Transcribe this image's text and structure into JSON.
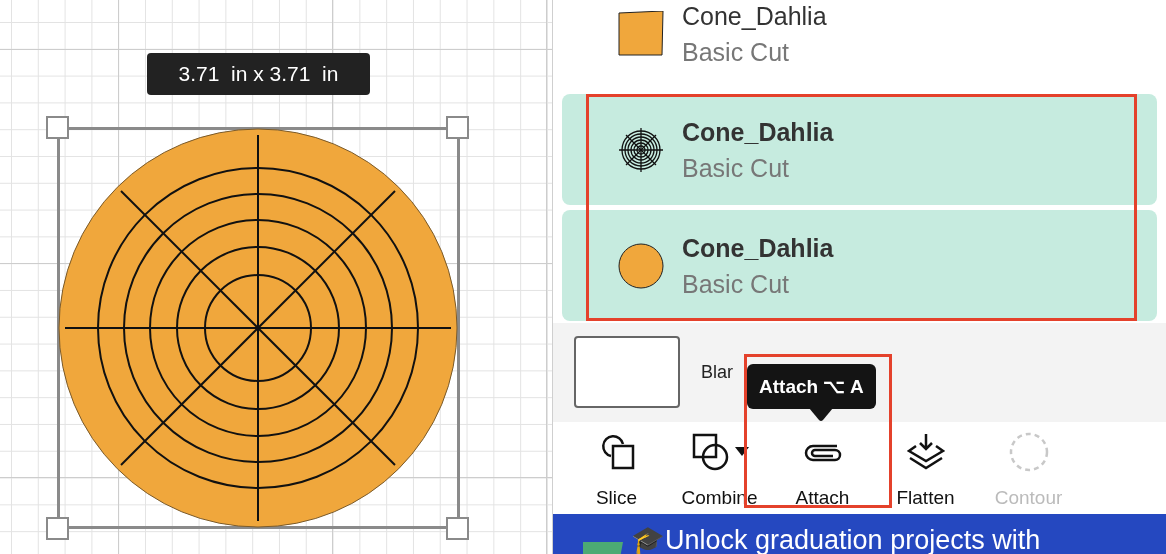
{
  "canvas": {
    "dimension_label": "3.71  in x 3.71  in"
  },
  "layers": [
    {
      "name": "Cone_Dahlia",
      "operation": "Basic Cut",
      "kind": "square",
      "selected": false
    },
    {
      "name": "Cone_Dahlia",
      "operation": "Basic Cut",
      "kind": "web",
      "selected": true
    },
    {
      "name": "Cone_Dahlia",
      "operation": "Basic Cut",
      "kind": "circle",
      "selected": true
    }
  ],
  "blank_canvas": {
    "label": "Blar"
  },
  "tooltip": {
    "text": "Attach ⌥ A"
  },
  "toolbar": [
    {
      "label": "Slice",
      "kind": "slice",
      "disabled": false,
      "has_menu": false
    },
    {
      "label": "Combine",
      "kind": "combine",
      "disabled": false,
      "has_menu": true
    },
    {
      "label": "Attach",
      "kind": "attach",
      "disabled": false,
      "has_menu": false
    },
    {
      "label": "Flatten",
      "kind": "flatten",
      "disabled": false,
      "has_menu": false
    },
    {
      "label": "Contour",
      "kind": "contour",
      "disabled": true,
      "has_menu": false
    }
  ],
  "banner": {
    "icon": "🎓",
    "text": "Unlock graduation projects with"
  }
}
